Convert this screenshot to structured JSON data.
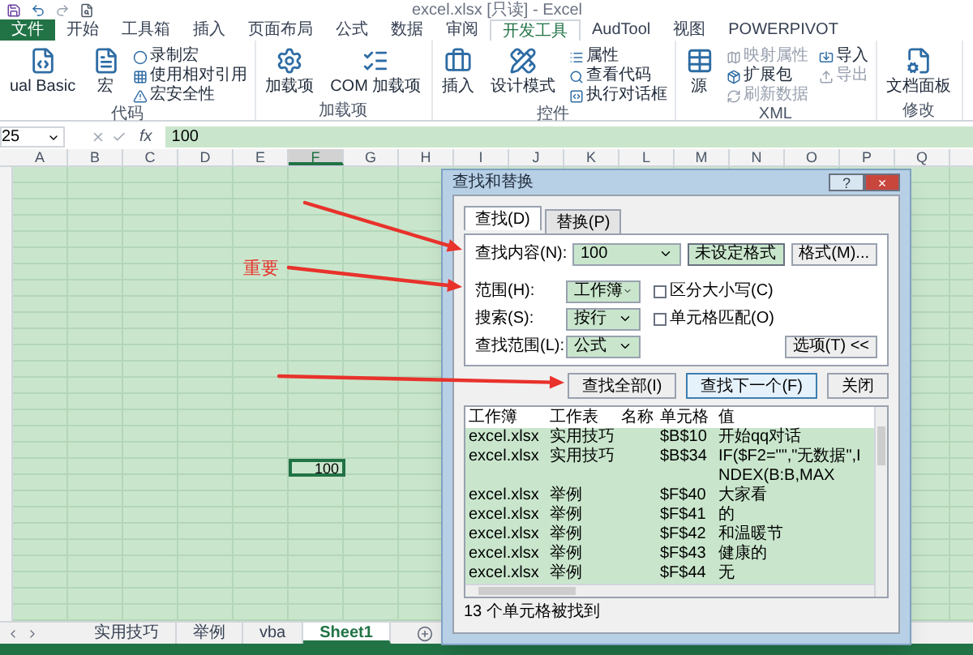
{
  "title_bar": {
    "title": "excel.xlsx [只读] - Excel"
  },
  "ribbon_tabs": [
    {
      "label": "文件",
      "kind": "file",
      "selected": false
    },
    {
      "label": "开始",
      "kind": "tab",
      "selected": false
    },
    {
      "label": "工具箱",
      "kind": "tab",
      "selected": false
    },
    {
      "label": "插入",
      "kind": "tab",
      "selected": false
    },
    {
      "label": "页面布局",
      "kind": "tab",
      "selected": false
    },
    {
      "label": "公式",
      "kind": "tab",
      "selected": false
    },
    {
      "label": "数据",
      "kind": "tab",
      "selected": false
    },
    {
      "label": "审阅",
      "kind": "tab",
      "selected": false
    },
    {
      "label": "开发工具",
      "kind": "tab",
      "selected": true
    },
    {
      "label": "AudTool",
      "kind": "tab",
      "selected": false
    },
    {
      "label": "视图",
      "kind": "tab",
      "selected": false
    },
    {
      "label": "POWERPIVOT",
      "kind": "tab",
      "selected": false
    }
  ],
  "ribbon_groups": [
    {
      "label": "代码",
      "items": [
        {
          "kind": "large",
          "label": "ual Basic"
        },
        {
          "kind": "large",
          "label": "宏"
        },
        {
          "kind": "stack",
          "items": [
            {
              "label": "录制宏",
              "disabled": false
            },
            {
              "label": "使用相对引用",
              "disabled": false
            },
            {
              "label": "宏安全性",
              "disabled": false
            }
          ]
        }
      ]
    },
    {
      "label": "加载项",
      "items": [
        {
          "kind": "large",
          "label": "加载项"
        },
        {
          "kind": "large",
          "label": "COM 加载项"
        }
      ]
    },
    {
      "label": "控件",
      "items": [
        {
          "kind": "large",
          "label": "插入"
        },
        {
          "kind": "large",
          "label": "设计模式"
        },
        {
          "kind": "stack",
          "items": [
            {
              "label": "属性",
              "disabled": false
            },
            {
              "label": "查看代码",
              "disabled": false
            },
            {
              "label": "执行对话框",
              "disabled": false
            }
          ]
        }
      ]
    },
    {
      "label": "XML",
      "items": [
        {
          "kind": "large",
          "label": "源"
        },
        {
          "kind": "stack",
          "items": [
            {
              "label": "映射属性",
              "disabled": true
            },
            {
              "label": "扩展包",
              "disabled": false
            },
            {
              "label": "刷新数据",
              "disabled": true
            }
          ]
        },
        {
          "kind": "stack",
          "items": [
            {
              "label": "导入",
              "disabled": false
            },
            {
              "label": "导出",
              "disabled": true
            }
          ]
        }
      ]
    },
    {
      "label": "修改",
      "items": [
        {
          "kind": "large",
          "label": "文档面板"
        }
      ]
    }
  ],
  "formula_bar": {
    "name_box": "25",
    "function_symbol": "fx",
    "formula": "100"
  },
  "columns": [
    {
      "label": "A",
      "selected": false
    },
    {
      "label": "B",
      "selected": false
    },
    {
      "label": "C",
      "selected": false
    },
    {
      "label": "D",
      "selected": false
    },
    {
      "label": "E",
      "selected": false
    },
    {
      "label": "F",
      "selected": true
    },
    {
      "label": "G",
      "selected": false
    },
    {
      "label": "H",
      "selected": false
    },
    {
      "label": "I",
      "selected": false
    },
    {
      "label": "J",
      "selected": false
    },
    {
      "label": "K",
      "selected": false
    },
    {
      "label": "L",
      "selected": false
    },
    {
      "label": "M",
      "selected": false
    },
    {
      "label": "N",
      "selected": false
    },
    {
      "label": "O",
      "selected": false
    },
    {
      "label": "P",
      "selected": false
    },
    {
      "label": "Q",
      "selected": false
    }
  ],
  "active_cell": {
    "value": "100"
  },
  "annotation": {
    "label": "重要"
  },
  "dialog": {
    "title": "查找和替换",
    "title_buttons": [
      "?",
      "×"
    ],
    "tabs": [
      {
        "label": "查找(D)",
        "selected": true
      },
      {
        "label": "替换(P)",
        "selected": false
      }
    ],
    "find_label": "查找内容(N):",
    "find_value": "100",
    "format_status": "未设定格式",
    "format_button": "格式(M)...",
    "options": [
      {
        "label": "范围(H):",
        "value": "工作簿"
      },
      {
        "label": "搜索(S):",
        "value": "按行"
      },
      {
        "label": "查找范围(L):",
        "value": "公式"
      }
    ],
    "checkboxes": [
      {
        "label": "区分大小写(C)",
        "checked": false
      },
      {
        "label": "单元格匹配(O)",
        "checked": false
      }
    ],
    "options_button": "选项(T) <<",
    "buttons": [
      {
        "label": "查找全部(I)",
        "focused": false
      },
      {
        "label": "查找下一个(F)",
        "focused": true
      },
      {
        "label": "关闭",
        "focused": false
      }
    ],
    "results": {
      "columns": [
        "工作簿",
        "工作表",
        "名称",
        "单元格",
        "值"
      ],
      "rows": [
        [
          "excel.xlsx",
          "实用技巧",
          "",
          "$B$10",
          "开始qq对话"
        ],
        [
          "excel.xlsx",
          "实用技巧",
          "",
          "$B$34",
          "IF($F2=\"\",\"无数据\",INDEX(B:B,MAX"
        ],
        [
          "excel.xlsx",
          "举例",
          "",
          "$F$40",
          "大家看"
        ],
        [
          "excel.xlsx",
          "举例",
          "",
          "$F$41",
          "的"
        ],
        [
          "excel.xlsx",
          "举例",
          "",
          "$F$42",
          "和温暖节"
        ],
        [
          "excel.xlsx",
          "举例",
          "",
          "$F$43",
          "健康的"
        ],
        [
          "excel.xlsx",
          "举例",
          "",
          "$F$44",
          "无"
        ]
      ]
    },
    "status": "13 个单元格被找到"
  },
  "sheet_tabs": [
    {
      "label": "实用技巧",
      "selected": false
    },
    {
      "label": "举例",
      "selected": false
    },
    {
      "label": "vba",
      "selected": false
    },
    {
      "label": "Sheet1",
      "selected": true
    }
  ]
}
